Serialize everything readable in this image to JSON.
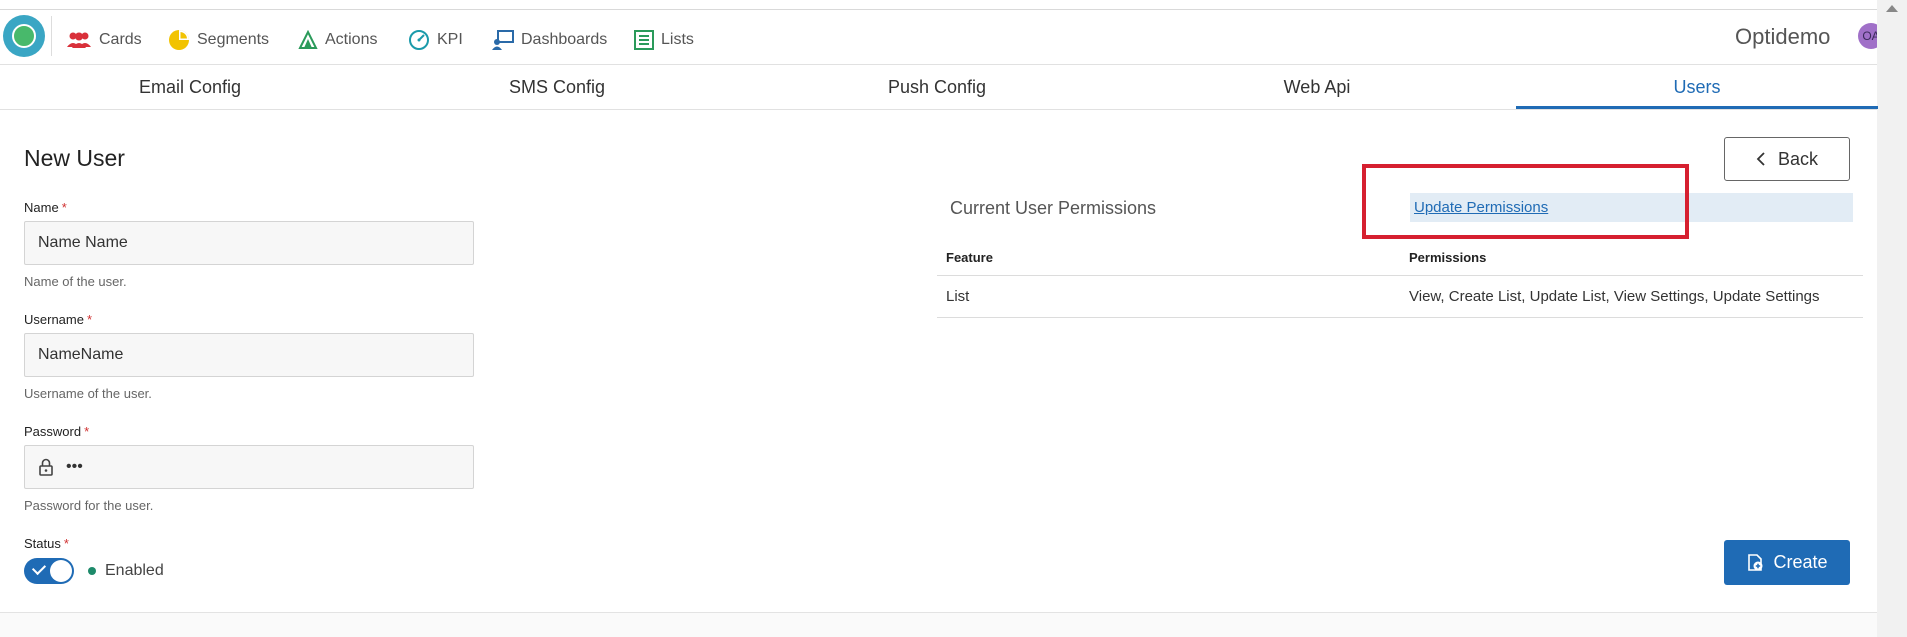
{
  "nav": {
    "items": [
      {
        "label": "Cards",
        "icon": "users-icon",
        "color": "#d9303a"
      },
      {
        "label": "Segments",
        "icon": "pie-chart-icon",
        "color": "#f2c300"
      },
      {
        "label": "Actions",
        "icon": "sail-icon",
        "color": "#2a9a5a"
      },
      {
        "label": "KPI",
        "icon": "gauge-icon",
        "color": "#1a9aaa"
      },
      {
        "label": "Dashboards",
        "icon": "dashboard-icon",
        "color": "#2a6aa8"
      },
      {
        "label": "Lists",
        "icon": "list-icon",
        "color": "#2a9a5a"
      }
    ],
    "brand": "Optidemo",
    "avatar_initials": "OA"
  },
  "tabs": [
    {
      "label": "Email Config"
    },
    {
      "label": "SMS Config"
    },
    {
      "label": "Push Config"
    },
    {
      "label": "Web Api"
    },
    {
      "label": "Users",
      "active": true
    }
  ],
  "form": {
    "title": "New User",
    "name": {
      "label": "Name",
      "required": "*",
      "value": "Name Name",
      "help": "Name of the user."
    },
    "username": {
      "label": "Username",
      "required": "*",
      "value": "NameName",
      "help": "Username of the user."
    },
    "password": {
      "label": "Password",
      "required": "*",
      "value": "•••",
      "help": "Password for the user."
    },
    "status": {
      "label": "Status",
      "required": "*",
      "value": "Enabled",
      "enabled": true
    }
  },
  "buttons": {
    "back": "Back",
    "create": "Create"
  },
  "permissions": {
    "title": "Current User Permissions",
    "update_link": "Update Permissions",
    "columns": [
      "Feature",
      "Permissions"
    ],
    "rows": [
      {
        "feature": "List",
        "permissions": "View, Create List, Update List, View Settings, Update Settings"
      }
    ]
  },
  "colors": {
    "accent": "#1f6bb5",
    "highlight": "#d62030",
    "status_enabled": "#1d8a6a"
  }
}
